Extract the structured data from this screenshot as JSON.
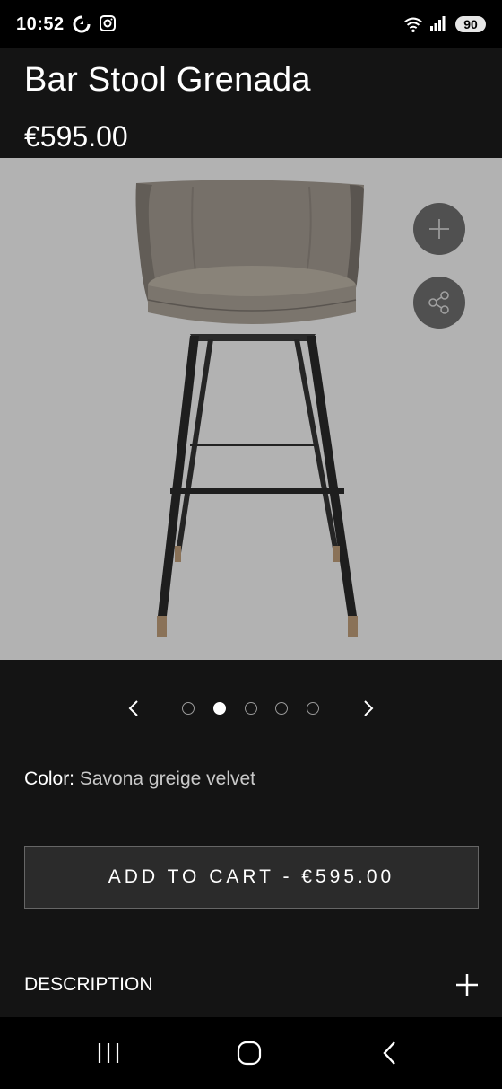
{
  "status_bar": {
    "time": "10:52",
    "battery": "90",
    "icons": [
      "sync-icon",
      "instagram-icon",
      "wifi-icon",
      "signal-icon"
    ]
  },
  "product": {
    "title": "Bar Stool Grenada",
    "price": "€595.00"
  },
  "gallery": {
    "image_subject": "bar-stool-image",
    "background_color": "#b2b2b2",
    "add_icon": "plus-icon",
    "share_icon": "share-icon"
  },
  "carousel": {
    "dot_count": 5,
    "active_index": 1
  },
  "color": {
    "label": "Color:",
    "value": "Savona greige velvet"
  },
  "cart": {
    "button_label": "ADD TO CART - €595.00"
  },
  "description": {
    "label": "DESCRIPTION",
    "toggle_icon": "plus-icon"
  },
  "nav": {
    "buttons": [
      "recent-apps-icon",
      "home-icon",
      "back-icon"
    ]
  }
}
